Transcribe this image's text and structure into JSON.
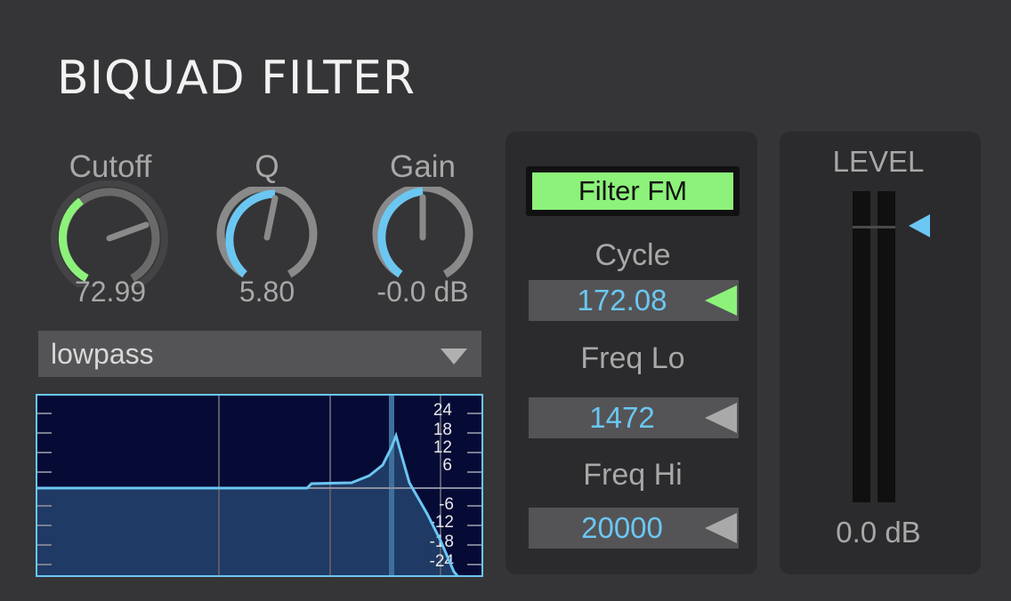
{
  "title": "BIQUAD FILTER",
  "knobs": [
    {
      "label": "Cutoff",
      "value": "72.99",
      "accent": "#8cf27a"
    },
    {
      "label": "Q",
      "value": "5.80",
      "accent": "#6bc7f2"
    },
    {
      "label": "Gain",
      "value": "-0.0 dB",
      "accent": "#6bc7f2"
    }
  ],
  "filter_type": {
    "selected": "lowpass"
  },
  "graph": {
    "gain_labels_top": [
      "24",
      "18",
      "12",
      "6"
    ],
    "gain_labels_bottom": [
      "-6",
      "-12",
      "-18",
      "-24"
    ]
  },
  "fm": {
    "button_label": "Filter FM",
    "cycle": {
      "label": "Cycle",
      "value": "172.08"
    },
    "freq_lo": {
      "label": "Freq Lo",
      "value": "1472"
    },
    "freq_hi": {
      "label": "Freq Hi",
      "value": "20000"
    }
  },
  "level": {
    "label": "LEVEL",
    "value": "0.0 dB"
  },
  "colors": {
    "background": "#353537",
    "panel": "#2b2b2d",
    "accent_blue": "#6bc7f2",
    "accent_green": "#8cf27a",
    "graph_bg": "#060b36",
    "graph_fill": "#1f3a64"
  }
}
